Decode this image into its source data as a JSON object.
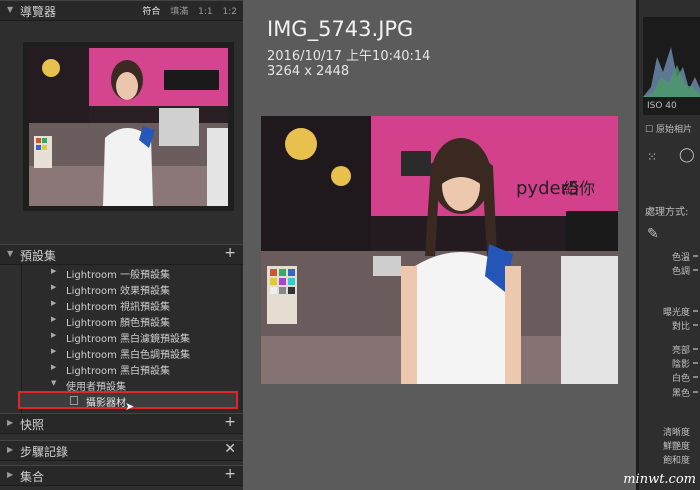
{
  "navigator": {
    "title": "導覽器",
    "options": [
      "符合",
      "填滿",
      "1:1",
      "1:2"
    ],
    "active_option": "符合"
  },
  "presets": {
    "title": "預設集",
    "items": [
      "Lightroom 一般預設集",
      "Lightroom 效果預設集",
      "Lightroom 視訊預設集",
      "Lightroom 顏色預設集",
      "Lightroom 黑白濾鏡預設集",
      "Lightroom 黑白色調預設集",
      "Lightroom 黑白預設集",
      "使用者預設集"
    ],
    "selected_item": "攝影器材"
  },
  "panels": {
    "snapshots": "快照",
    "history": "步驟記錄",
    "collections": "集合"
  },
  "photo_info": {
    "filename": "IMG_5743.JPG",
    "datetime": "2016/10/17 上午10:40:14",
    "dimensions": "3264 x 2448"
  },
  "right_panel": {
    "iso": "ISO 40",
    "original_label": "原始相片",
    "process_label": "處理方式:",
    "labels_a": [
      "色溫",
      "色調"
    ],
    "labels_b": [
      "曝光度",
      "對比"
    ],
    "labels_c": [
      "亮部",
      "陰影",
      "白色",
      "黑色"
    ],
    "labels_d": [
      "清晰度",
      "鮮艷度",
      "飽和度"
    ]
  },
  "watermark": "minwt.com",
  "colors": {
    "highlight_border": "#e0262b",
    "panel_bg": "#2e2e2e",
    "center_bg": "#5b5b5b"
  }
}
